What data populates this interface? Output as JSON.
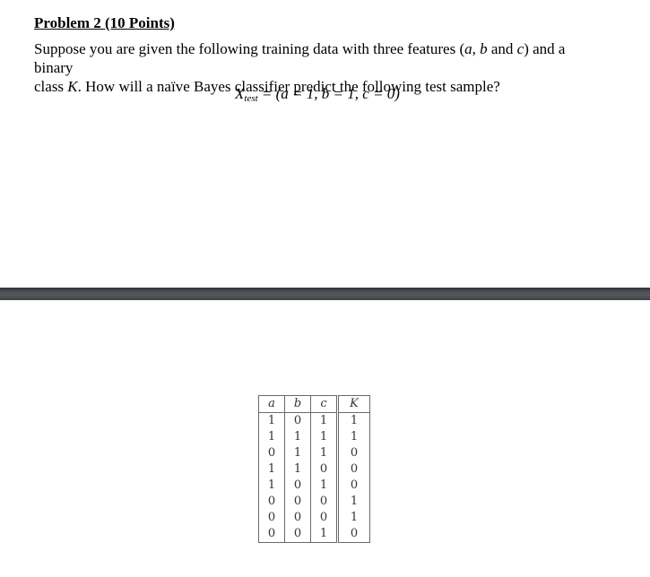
{
  "problem": {
    "title": "Problem 2 (10 Points)",
    "text_line1_a": "Suppose you are given the following training data with three features (",
    "var_a": "a",
    "sep1": ", ",
    "var_b": "b",
    "and": " and ",
    "var_c": "c",
    "text_line1_b": ") and a binary",
    "text_line2_a": "class ",
    "var_K": "K",
    "text_line2_b": ". How will a naïve Bayes classifier predict the following test sample?",
    "formula_X": "X",
    "formula_sub": "test",
    "formula_rest": " = (a = 1, b = 1, c = 0)"
  },
  "table": {
    "headers": [
      "a",
      "b",
      "c",
      "K"
    ],
    "rows": [
      [
        "1",
        "0",
        "1",
        "1"
      ],
      [
        "1",
        "1",
        "1",
        "1"
      ],
      [
        "0",
        "1",
        "1",
        "0"
      ],
      [
        "1",
        "1",
        "0",
        "0"
      ],
      [
        "1",
        "0",
        "1",
        "0"
      ],
      [
        "0",
        "0",
        "0",
        "1"
      ],
      [
        "0",
        "0",
        "0",
        "1"
      ],
      [
        "0",
        "0",
        "1",
        "0"
      ]
    ]
  }
}
